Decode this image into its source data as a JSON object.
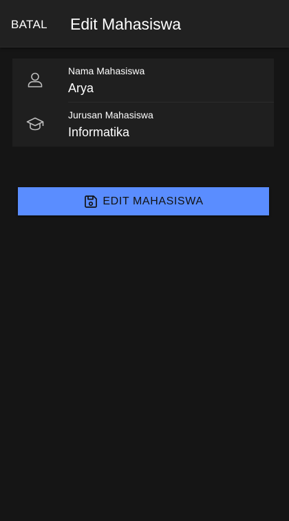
{
  "header": {
    "cancel_label": "BATAL",
    "title": "Edit Mahasiswa"
  },
  "form": {
    "fields": [
      {
        "label": "Nama Mahasiswa",
        "value": "Arya",
        "icon": "person-icon"
      },
      {
        "label": "Jurusan Mahasiswa",
        "value": "Informatika",
        "icon": "graduation-cap-icon"
      }
    ]
  },
  "actions": {
    "edit_label": "EDIT MAHASISWA",
    "edit_icon": "save-icon"
  },
  "colors": {
    "background": "#151515",
    "header": "#212121",
    "card": "#1f1f1f",
    "accent": "#5a8dff",
    "text": "#ffffff"
  }
}
